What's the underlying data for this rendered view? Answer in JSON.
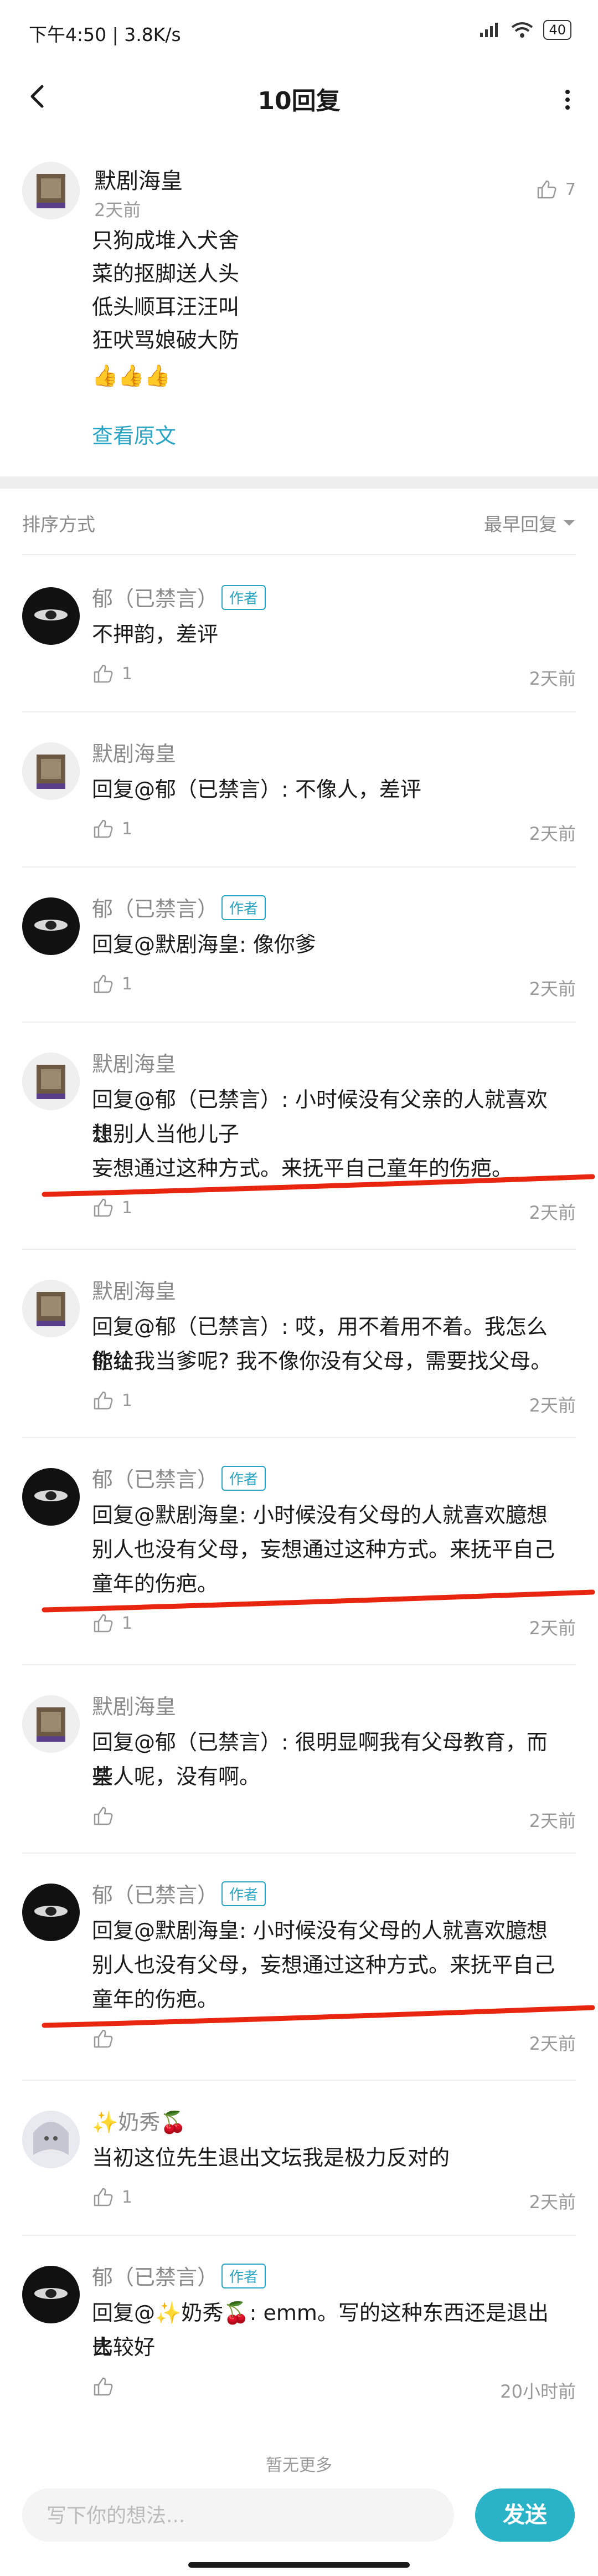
{
  "status_bar": {
    "left_text": "下午4:50 | 3.8K/s",
    "battery": "40"
  },
  "nav": {
    "title": "10回复"
  },
  "main_post": {
    "user": "默剧海皇",
    "time": "2天前",
    "likes": "7",
    "lines": [
      "只狗成堆入犬舍",
      "菜的抠脚送人头",
      "低头顺耳汪汪叫",
      "狂吠骂娘破大防"
    ],
    "emoji": "👍👍👍",
    "view_original": "查看原文"
  },
  "sort": {
    "label": "排序方式",
    "value": "最早回复"
  },
  "author_badge": "作者",
  "comments": [
    {
      "user": "郁（已禁言）",
      "author": true,
      "avatar": "dark",
      "lines": [
        "不押韵，差评"
      ],
      "likes": "1",
      "time": "2天前"
    },
    {
      "user": "默剧海皇",
      "author": false,
      "avatar": "grid",
      "lines": [
        "回复@郁（已禁言）: 不像人，差评"
      ],
      "likes": "1",
      "time": "2天前"
    },
    {
      "user": "郁（已禁言）",
      "author": true,
      "avatar": "dark",
      "lines": [
        "回复@默剧海皇: 像你爹"
      ],
      "likes": "1",
      "time": "2天前"
    },
    {
      "user": "默剧海皇",
      "author": false,
      "avatar": "grid",
      "lines": [
        "回复@郁（已禁言）: 小时候没有父亲的人就喜欢想",
        "让别人当他儿子",
        "妄想通过这种方式。来抚平自己童年的伤疤。"
      ],
      "likes": "1",
      "time": "2天前"
    },
    {
      "user": "默剧海皇",
      "author": false,
      "avatar": "grid",
      "lines": [
        "回复@郁（已禁言）: 哎，用不着用不着。我怎么能让",
        "你给我当爹呢? 我不像你没有父母，需要找父母。"
      ],
      "likes": "1",
      "time": "2天前"
    },
    {
      "user": "郁（已禁言）",
      "author": true,
      "avatar": "dark",
      "lines": [
        "回复@默剧海皇: 小时候没有父母的人就喜欢臆想",
        "别人也没有父母，妄想通过这种方式。来抚平自己",
        "童年的伤疤。"
      ],
      "likes": "1",
      "time": "2天前"
    },
    {
      "user": "默剧海皇",
      "author": false,
      "avatar": "grid",
      "lines": [
        "回复@郁（已禁言）: 很明显啊我有父母教育，而某",
        "些人呢，没有啊。"
      ],
      "likes": "",
      "time": "2天前"
    },
    {
      "user": "郁（已禁言）",
      "author": true,
      "avatar": "dark",
      "lines": [
        "回复@默剧海皇: 小时候没有父母的人就喜欢臆想",
        "别人也没有父母，妄想通过这种方式。来抚平自己",
        "童年的伤疤。"
      ],
      "likes": "",
      "time": "2天前"
    },
    {
      "user": "✨奶秀🍒",
      "author": false,
      "avatar": "anime",
      "lines": [
        "当初这位先生退出文坛我是极力反对的"
      ],
      "likes": "1",
      "time": "2天前"
    },
    {
      "user": "郁（已禁言）",
      "author": true,
      "avatar": "dark",
      "lines": [
        "回复@✨奶秀🍒: emm。写的这种东西还是退出去",
        "比较好"
      ],
      "likes": "",
      "time": "20小时前"
    }
  ],
  "no_more": "暂无更多",
  "input": {
    "placeholder": "写下你的想法...",
    "send_label": "发送"
  },
  "colors": {
    "accent": "#2aa4c3",
    "send_bg": "#2ab3c7",
    "annotation_red": "#e8260f"
  }
}
